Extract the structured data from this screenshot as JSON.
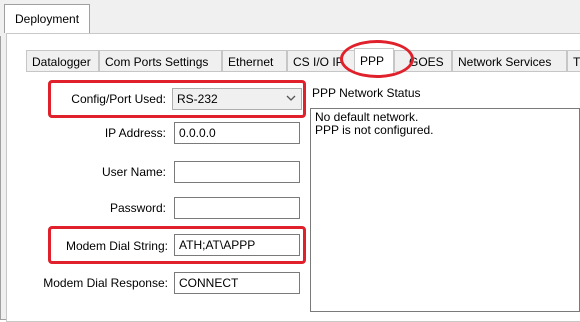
{
  "window": {
    "top_tab": "Deployment"
  },
  "tabs": [
    {
      "label": "Datalogger"
    },
    {
      "label": "Com Ports Settings"
    },
    {
      "label": "Ethernet"
    },
    {
      "label": "CS I/O IP"
    },
    {
      "label": "PPP",
      "active": true
    },
    {
      "label": "GOES"
    },
    {
      "label": "Network Services"
    },
    {
      "label": "T"
    }
  ],
  "form": {
    "config_port": {
      "label": "Config/Port Used:",
      "value": "RS-232"
    },
    "ip_address": {
      "label": "IP Address:",
      "value": "0.0.0.0"
    },
    "user_name": {
      "label": "User Name:",
      "value": ""
    },
    "password": {
      "label": "Password:",
      "value": ""
    },
    "modem_dial_string": {
      "label": "Modem Dial String:",
      "value": "ATH;AT\\APPP"
    },
    "modem_dial_response": {
      "label": "Modem Dial Response:",
      "value": "CONNECT"
    }
  },
  "status": {
    "title": "PPP Network Status",
    "lines": [
      "No default network.",
      "PPP is not configured."
    ]
  },
  "annotation_color": "#e0202a",
  "icons": {
    "dropdown": "chevron-down-icon"
  }
}
